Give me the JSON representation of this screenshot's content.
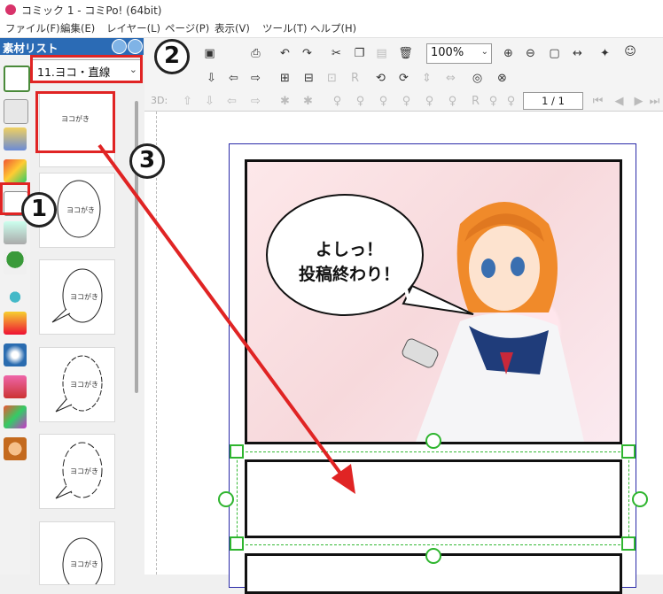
{
  "window": {
    "title": "コミック 1 - コミPo! (64bit)"
  },
  "menu": [
    "ファイル(F)",
    "編集(E)",
    "レイヤー(L)",
    "ページ(P)",
    "表示(V)",
    "ツール(T)",
    "ヘルプ(H)"
  ],
  "panel": {
    "title": "素材リスト",
    "dropdown_value": "11.ヨコ・直線",
    "thumb_label": "ヨコがき",
    "categories": [
      "layout-icon",
      "pose-icon",
      "character-icon",
      "3d-object-icon",
      "balloon-icon",
      "background-icon",
      "tree-icon",
      "drop-icon",
      "katakana-moji-icon",
      "effect-lines-icon",
      "user-icon",
      "user-3d-icon",
      "face-icon"
    ]
  },
  "toolbar": {
    "zoom": "100%",
    "page_indicator": "1 / 1",
    "label_3d": "3D:"
  },
  "canvas": {
    "bubble_line1": "よしっ！",
    "bubble_line2": "投稿終わり！"
  },
  "annotations": {
    "n1": "1",
    "n2": "2",
    "n3": "3"
  },
  "colors": {
    "accent_red": "#e02424",
    "selection_green": "#2fb52f",
    "panel_header": "#2b6bb5"
  }
}
